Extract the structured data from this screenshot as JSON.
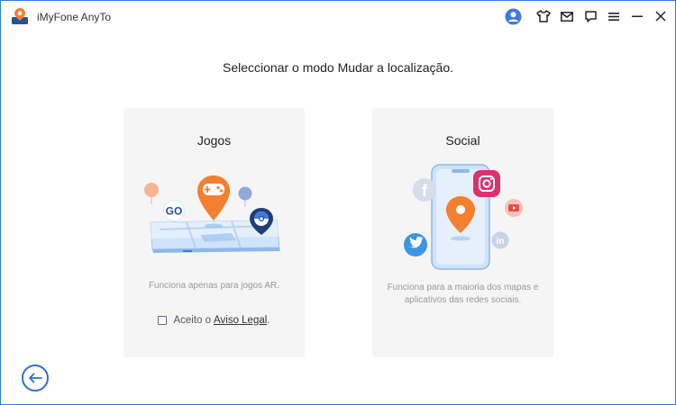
{
  "window": {
    "title": "iMyFone AnyTo",
    "toolbar_icons": [
      "user-icon",
      "tshirt-icon",
      "mail-icon",
      "feedback-icon",
      "menu-icon",
      "minimize-icon",
      "close-icon"
    ]
  },
  "main": {
    "heading": "Seleccionar o modo Mudar a localização."
  },
  "cards": {
    "games": {
      "title": "Jogos",
      "badge": "GO",
      "description": "Funciona apenas para jogos AR.",
      "agree_prefix": "Aceito o",
      "agree_link": "Aviso Legal",
      "agree_suffix": "."
    },
    "social": {
      "title": "Social",
      "description": "Funciona para a maioria dos mapas e aplicativos das redes sociais.",
      "social_icons": [
        "facebook-icon",
        "instagram-icon",
        "youtube-icon",
        "twitter-icon",
        "linkedin-icon"
      ]
    }
  },
  "colors": {
    "accent": "#2f6fcf",
    "pin_orange": "#f47f2f",
    "card_bg": "#f5f5f5"
  }
}
